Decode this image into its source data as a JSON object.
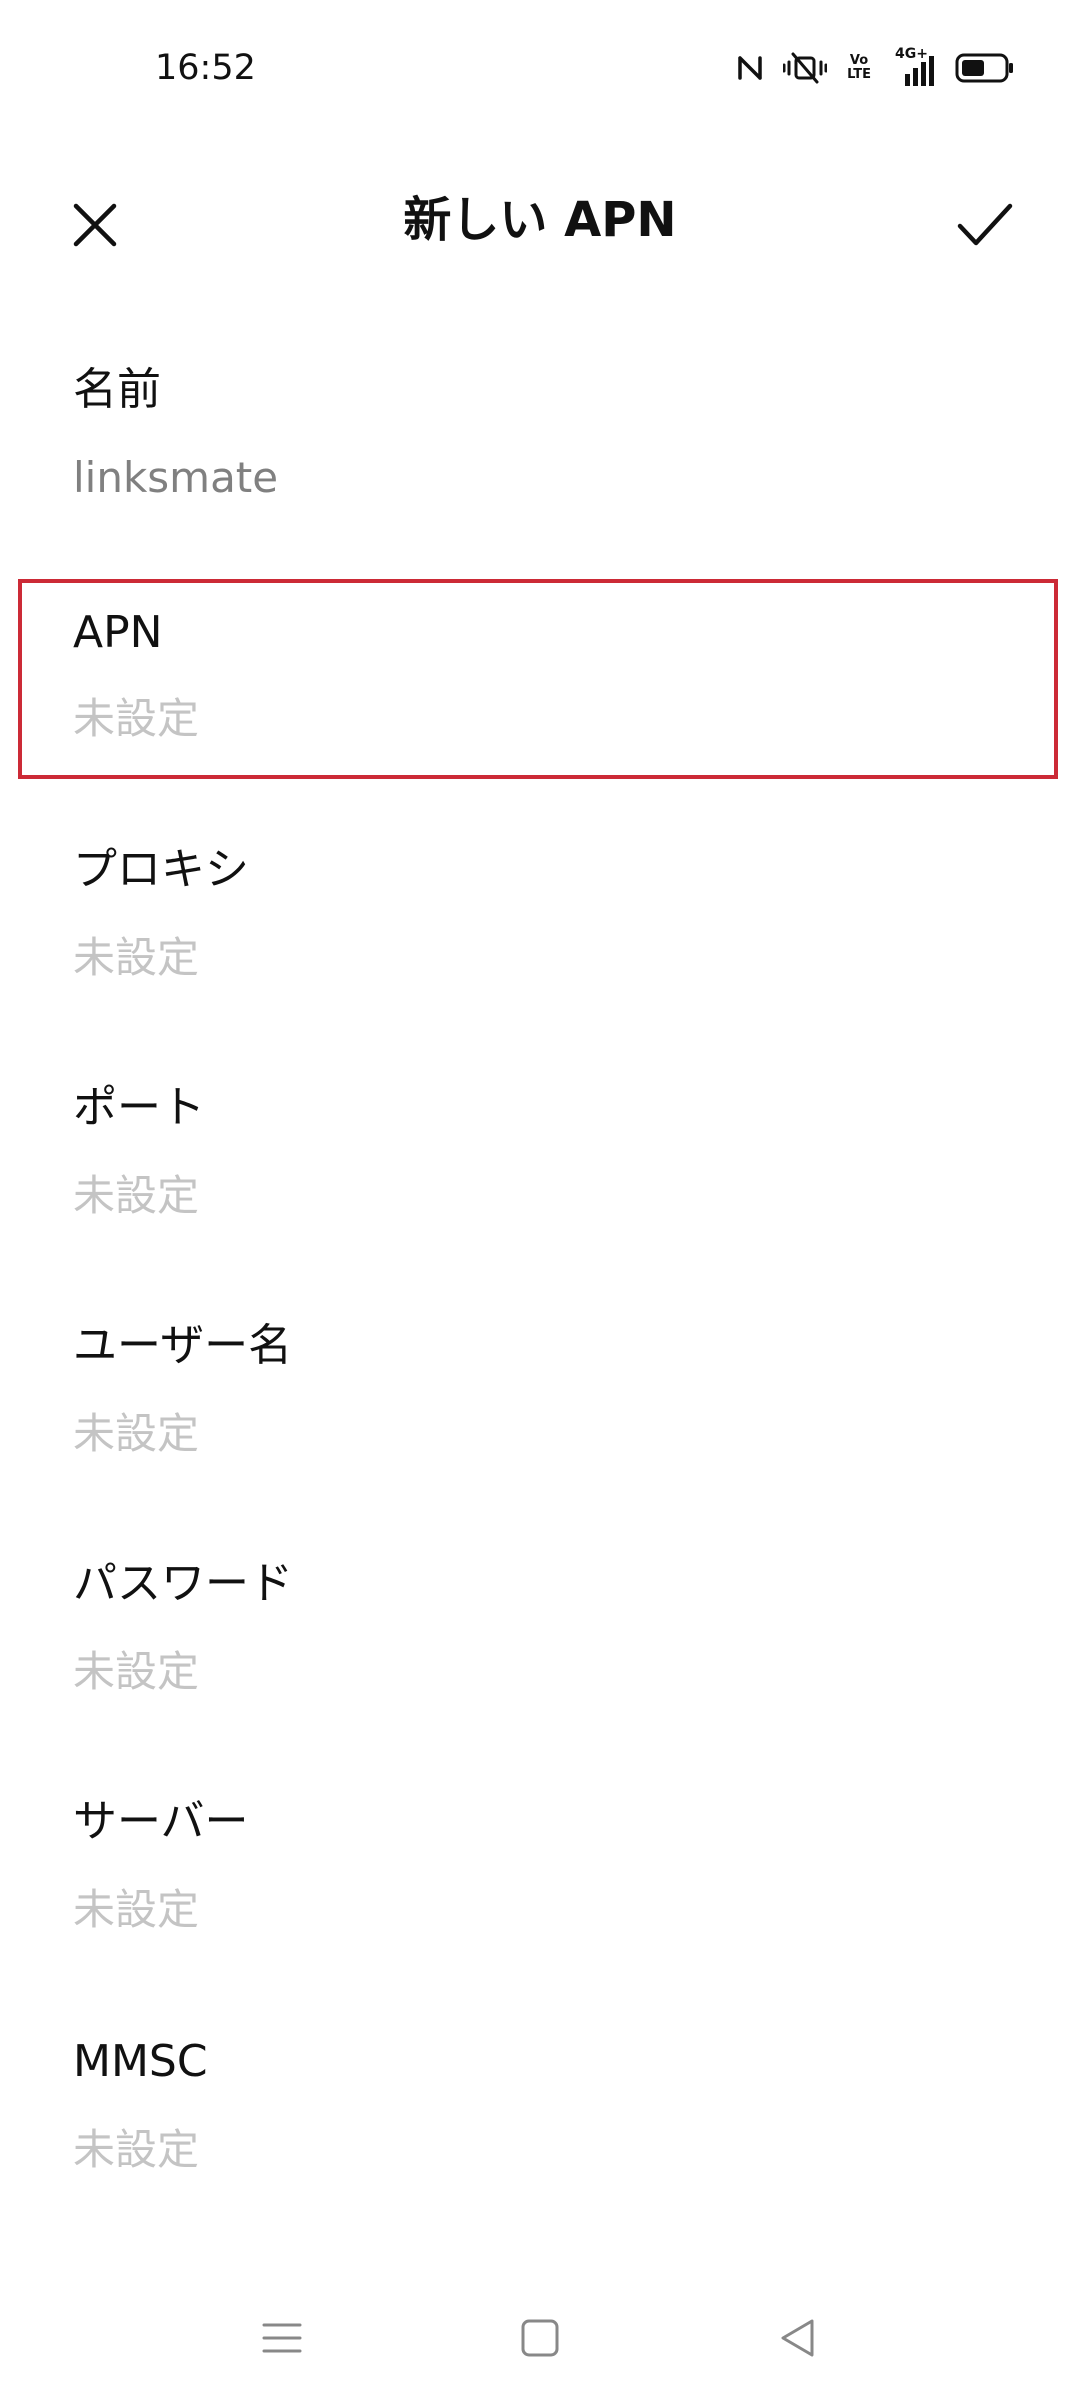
{
  "status_bar": {
    "time": "16:52",
    "icons": [
      "nfc-icon",
      "vibrate-icon",
      "volte-icon",
      "signal-4g-icon",
      "battery-icon"
    ],
    "volte_top": "Vo",
    "volte_bottom": "LTE",
    "network_type": "4G+"
  },
  "header": {
    "title": "新しい APN",
    "close_icon": "close-icon",
    "confirm_icon": "check-icon"
  },
  "fields": [
    {
      "label": "名前",
      "value": "linksmate",
      "filled": true
    },
    {
      "label": "APN",
      "value": "未設定",
      "filled": false,
      "highlighted": true
    },
    {
      "label": "プロキシ",
      "value": "未設定",
      "filled": false
    },
    {
      "label": "ポート",
      "value": "未設定",
      "filled": false
    },
    {
      "label": "ユーザー名",
      "value": "未設定",
      "filled": false
    },
    {
      "label": "パスワード",
      "value": "未設定",
      "filled": false
    },
    {
      "label": "サーバー",
      "value": "未設定",
      "filled": false
    },
    {
      "label": "MMSC",
      "value": "未設定",
      "filled": false
    }
  ],
  "nav_bar": {
    "icons": [
      "menu-icon",
      "home-icon",
      "back-icon"
    ]
  },
  "colors": {
    "highlight_border": "#cc2a36",
    "placeholder_text": "#c4c4c4",
    "filled_value_text": "#808080"
  }
}
